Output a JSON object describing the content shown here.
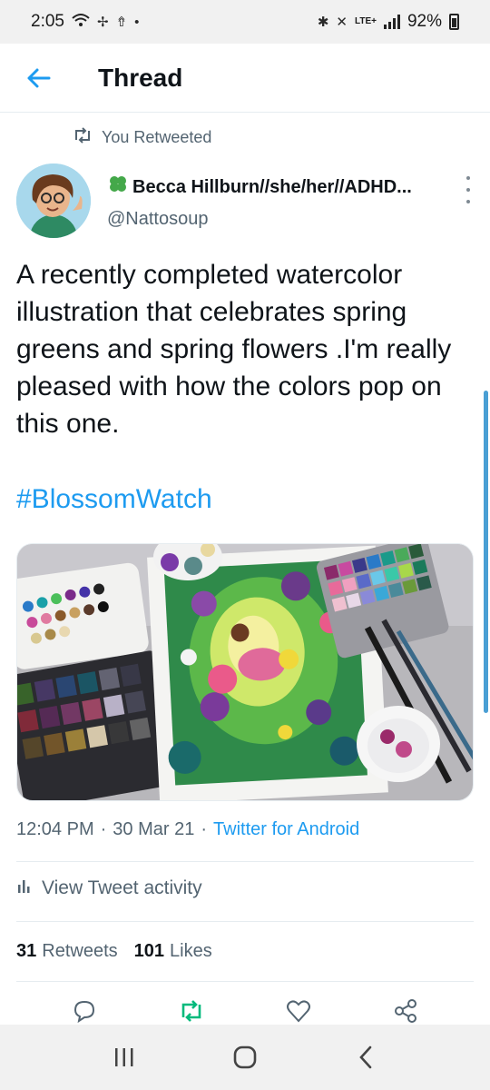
{
  "status_bar": {
    "time": "2:05",
    "network": "LTE+",
    "battery": "92%"
  },
  "header": {
    "title": "Thread"
  },
  "retweet_notice": "You Retweeted",
  "author": {
    "name": "Becca Hillburn//she/her//ADHD...",
    "handle": "@Nattosoup"
  },
  "tweet": {
    "text": "A recently completed watercolor illustration that celebrates spring greens and spring flowers .I'm really pleased with how the colors pop on this one.",
    "hashtag": "#BlossomWatch",
    "time": "12:04 PM",
    "date": "30 Mar 21",
    "source": "Twitter for Android"
  },
  "activity_label": "View Tweet activity",
  "stats": {
    "retweets_count": "31",
    "retweets_label": "Retweets",
    "likes_count": "101",
    "likes_label": "Likes"
  },
  "colors": {
    "accent": "#1d9bf0",
    "retweet_active": "#00ba7c",
    "secondary_text": "#536471"
  },
  "icons": [
    "wifi-icon",
    "fan-icon",
    "upload-icon",
    "bluetooth-icon",
    "mute-icon",
    "signal-icon",
    "battery-icon",
    "back-arrow-icon",
    "retweet-icon",
    "clover-icon",
    "more-icon",
    "activity-icon",
    "reply-icon",
    "like-icon",
    "share-icon",
    "recent-apps-icon",
    "home-icon",
    "back-icon"
  ]
}
